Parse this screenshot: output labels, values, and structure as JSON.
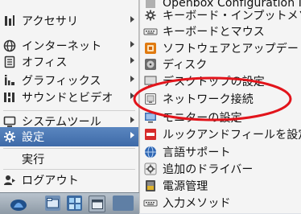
{
  "main_menu": {
    "items": [
      {
        "label": "アクセサリ",
        "icon": "accessories-icon"
      },
      {
        "label": "インターネット",
        "icon": "globe-icon"
      },
      {
        "label": "オフィス",
        "icon": "office-icon"
      },
      {
        "label": "グラフィックス",
        "icon": "graphics-icon"
      },
      {
        "label": "サウンドとビデオ",
        "icon": "sound-video-icon"
      },
      {
        "label": "システムツール",
        "icon": "system-tools-icon"
      },
      {
        "label": "設定",
        "icon": "settings-gear-icon"
      },
      {
        "label": "実行"
      },
      {
        "label": "ログアウト",
        "icon": "logout-icon"
      }
    ]
  },
  "submenu": {
    "items": [
      {
        "label": "Openbox Configuration M"
      },
      {
        "label": "キーボード・インプットメソッ"
      },
      {
        "label": "キーボードとマウス"
      },
      {
        "label": "ソフトウェアとアップデート"
      },
      {
        "label": "ディスク"
      },
      {
        "label": "デスクトップの設定"
      },
      {
        "label": "ネットワーク接続"
      },
      {
        "label": "モニターの設定"
      },
      {
        "label": "ルックアンドフィールを設定し"
      },
      {
        "label": "言語サポート"
      },
      {
        "label": "追加のドライバー"
      },
      {
        "label": "電源管理"
      },
      {
        "label": "入力メソッド"
      }
    ]
  },
  "colors": {
    "highlight_ring": "#e2141b",
    "active_item": "#4a76b4"
  }
}
